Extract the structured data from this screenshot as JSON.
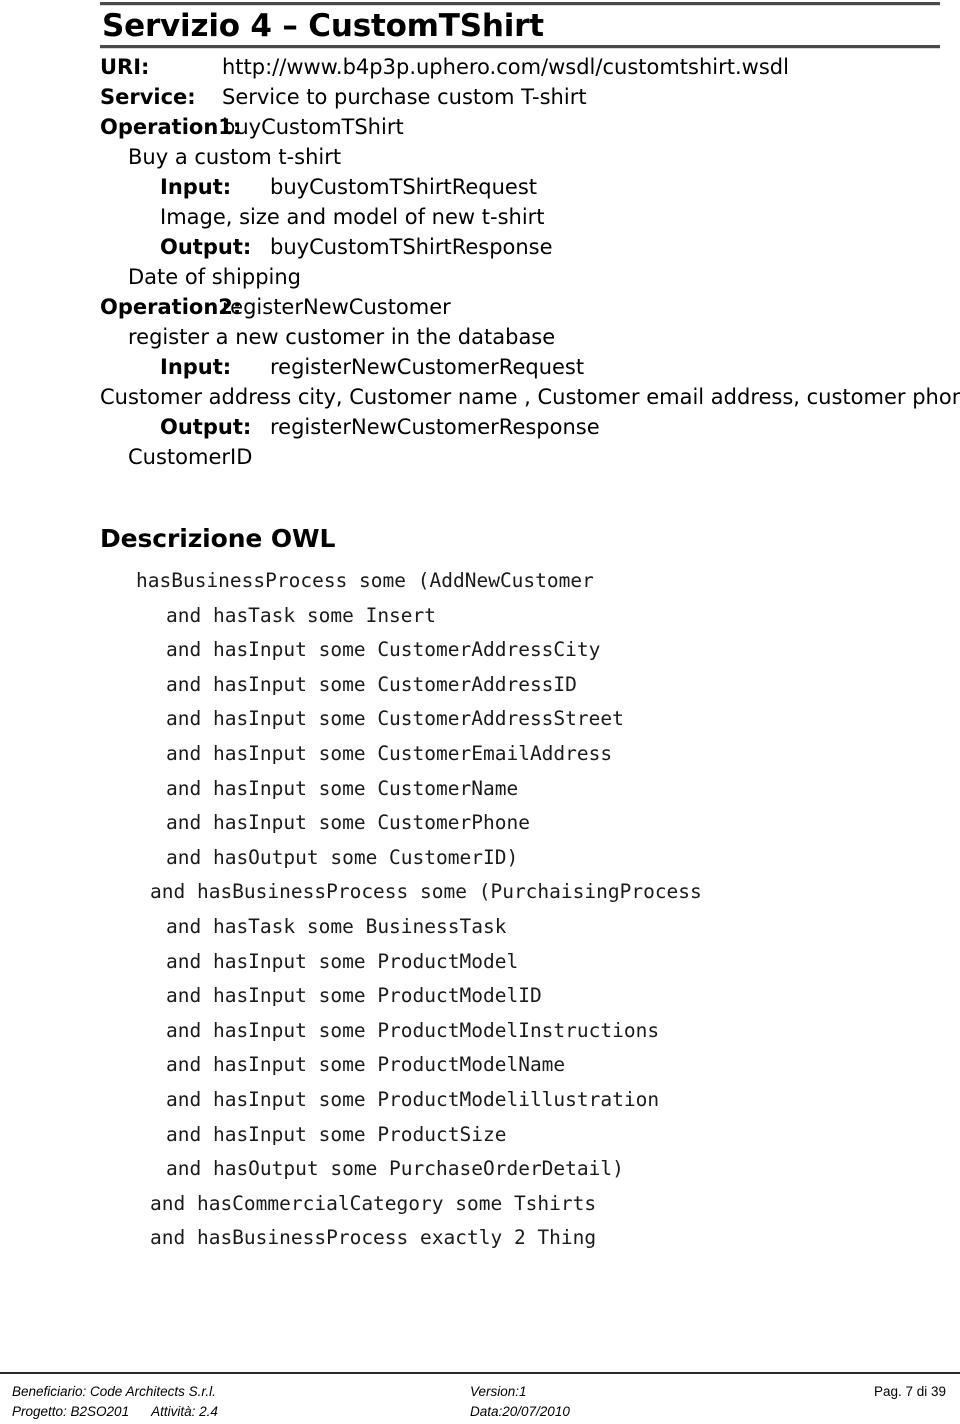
{
  "document": {
    "title": "Servizio 4 – CustomTShirt"
  },
  "service_spec": {
    "uri_label": "URI:",
    "uri_value": "http://www.b4p3p.uphero.com/wsdl/customtshirt.wsdl",
    "service_label": "Service:",
    "service_value": "Service to purchase custom T-shirt",
    "operation1_label": "Operation1:",
    "operation1_value": "buyCustomTShirt",
    "operation1_desc": "Buy a custom  t-shirt",
    "operation1_input_label": "Input:",
    "operation1_input_value": "buyCustomTShirtRequest",
    "operation1_input_desc": "Image, size and model of new t-shirt",
    "operation1_output_label": "Output:",
    "operation1_output_value": "buyCustomTShirtResponse",
    "operation1_output_desc": "Date of shipping",
    "operation2_label": "Operation2:",
    "operation2_value": "registerNewCustomer",
    "operation2_desc": "register a new customer in the database",
    "operation2_input_label": "Input:",
    "operation2_input_value": "registerNewCustomerRequest",
    "operation2_input_desc": "Customer address city, Customer name , Customer email address, customer phone",
    "operation2_output_label": "Output:",
    "operation2_output_value": "registerNewCustomerResponse",
    "operation2_output_desc": "CustomerID"
  },
  "owl_section": {
    "heading": "Descrizione OWL",
    "lines": [
      {
        "indent": 0,
        "text": "hasBusinessProcess some (AddNewCustomer"
      },
      {
        "indent": 1,
        "text": "and hasTask some Insert"
      },
      {
        "indent": 1,
        "text": "and hasInput some CustomerAddressCity"
      },
      {
        "indent": 1,
        "text": "and hasInput some CustomerAddressID"
      },
      {
        "indent": 1,
        "text": "and hasInput some CustomerAddressStreet"
      },
      {
        "indent": 1,
        "text": "and hasInput some CustomerEmailAddress"
      },
      {
        "indent": 1,
        "text": "and hasInput some CustomerName"
      },
      {
        "indent": 1,
        "text": "and hasInput some CustomerPhone"
      },
      {
        "indent": 1,
        "text": "and hasOutput some CustomerID)"
      },
      {
        "indent": 2,
        "text": "and hasBusinessProcess some (PurchaisingProcess"
      },
      {
        "indent": 1,
        "text": "and hasTask some BusinessTask"
      },
      {
        "indent": 1,
        "text": "and hasInput some ProductModel"
      },
      {
        "indent": 1,
        "text": "and hasInput some ProductModelID"
      },
      {
        "indent": 1,
        "text": "and hasInput some ProductModelInstructions"
      },
      {
        "indent": 1,
        "text": "and hasInput some ProductModelName"
      },
      {
        "indent": 1,
        "text": "and hasInput some ProductModelillustration"
      },
      {
        "indent": 1,
        "text": "and hasInput some ProductSize"
      },
      {
        "indent": 1,
        "text": "and hasOutput some PurchaseOrderDetail)"
      },
      {
        "indent": 2,
        "text": "and hasCommercialCategory some Tshirts"
      },
      {
        "indent": 2,
        "text": "and hasBusinessProcess exactly 2 Thing"
      }
    ]
  },
  "footer": {
    "beneficiario": "Beneficiario: Code Architects S.r.l.",
    "progetto": "Progetto: B2SO201",
    "attivita": "Attività: 2.4",
    "version": "Version:1",
    "data": "Data:20/07/2010",
    "page": "Pag. 7 di 39"
  }
}
